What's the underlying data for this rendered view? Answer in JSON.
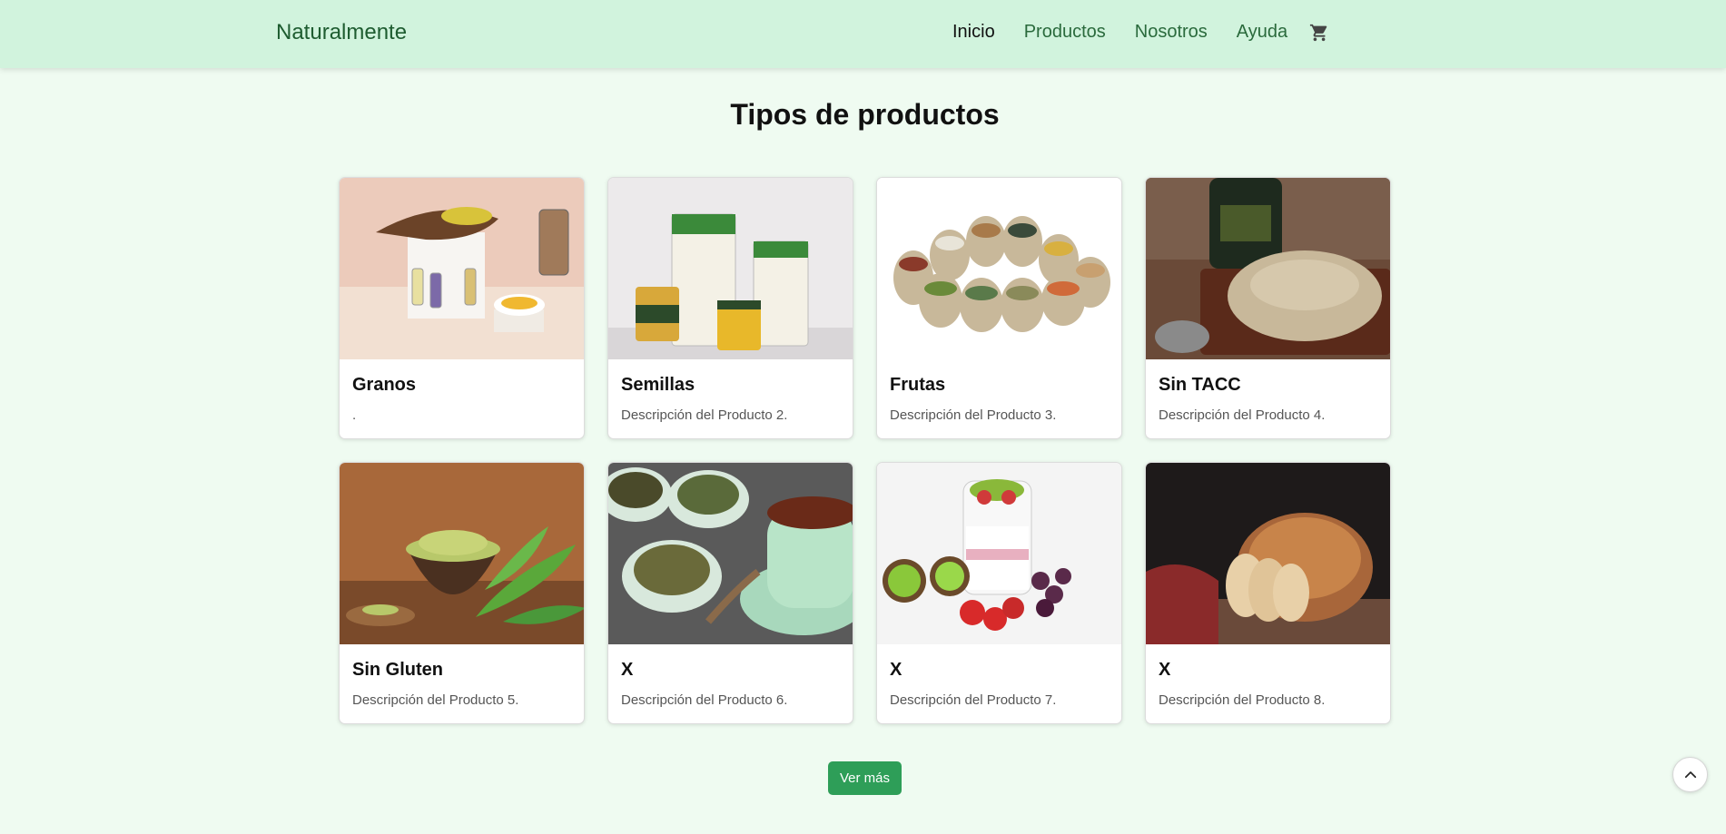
{
  "header": {
    "brand": "Naturalmente",
    "nav": [
      {
        "label": "Inicio",
        "active": true
      },
      {
        "label": "Productos",
        "active": false
      },
      {
        "label": "Nosotros",
        "active": false
      },
      {
        "label": "Ayuda",
        "active": false
      }
    ],
    "cart_icon": "shopping-cart-icon"
  },
  "main": {
    "title": "Tipos de productos",
    "cards": [
      {
        "title": "Granos",
        "description": ".",
        "image": "jars-and-wooden-spoon-photo"
      },
      {
        "title": "Semillas",
        "description": "Descripción del Producto 2.",
        "image": "seed-packages-photo"
      },
      {
        "title": "Frutas",
        "description": "Descripción del Producto 3.",
        "image": "grain-sacks-photo"
      },
      {
        "title": "Sin TACC",
        "description": "Descripción del Producto 4.",
        "image": "flour-bowl-photo"
      },
      {
        "title": "Sin Gluten",
        "description": "Descripción del Producto 5.",
        "image": "green-powder-photo"
      },
      {
        "title": "X",
        "description": "Descripción del Producto 6.",
        "image": "tea-cups-photo"
      },
      {
        "title": "X",
        "description": "Descripción del Producto 7.",
        "image": "yogurt-fruit-photo"
      },
      {
        "title": "X",
        "description": "Descripción del Producto 8.",
        "image": "bread-loaf-photo"
      }
    ],
    "more_button": "Ver más"
  },
  "scroll_top_icon": "chevron-up-icon",
  "colors": {
    "navbar_bg": "#d1f3dd",
    "page_bg": "#effbf1",
    "brand_green": "#1e5c30",
    "button_green": "#2e9e58"
  }
}
